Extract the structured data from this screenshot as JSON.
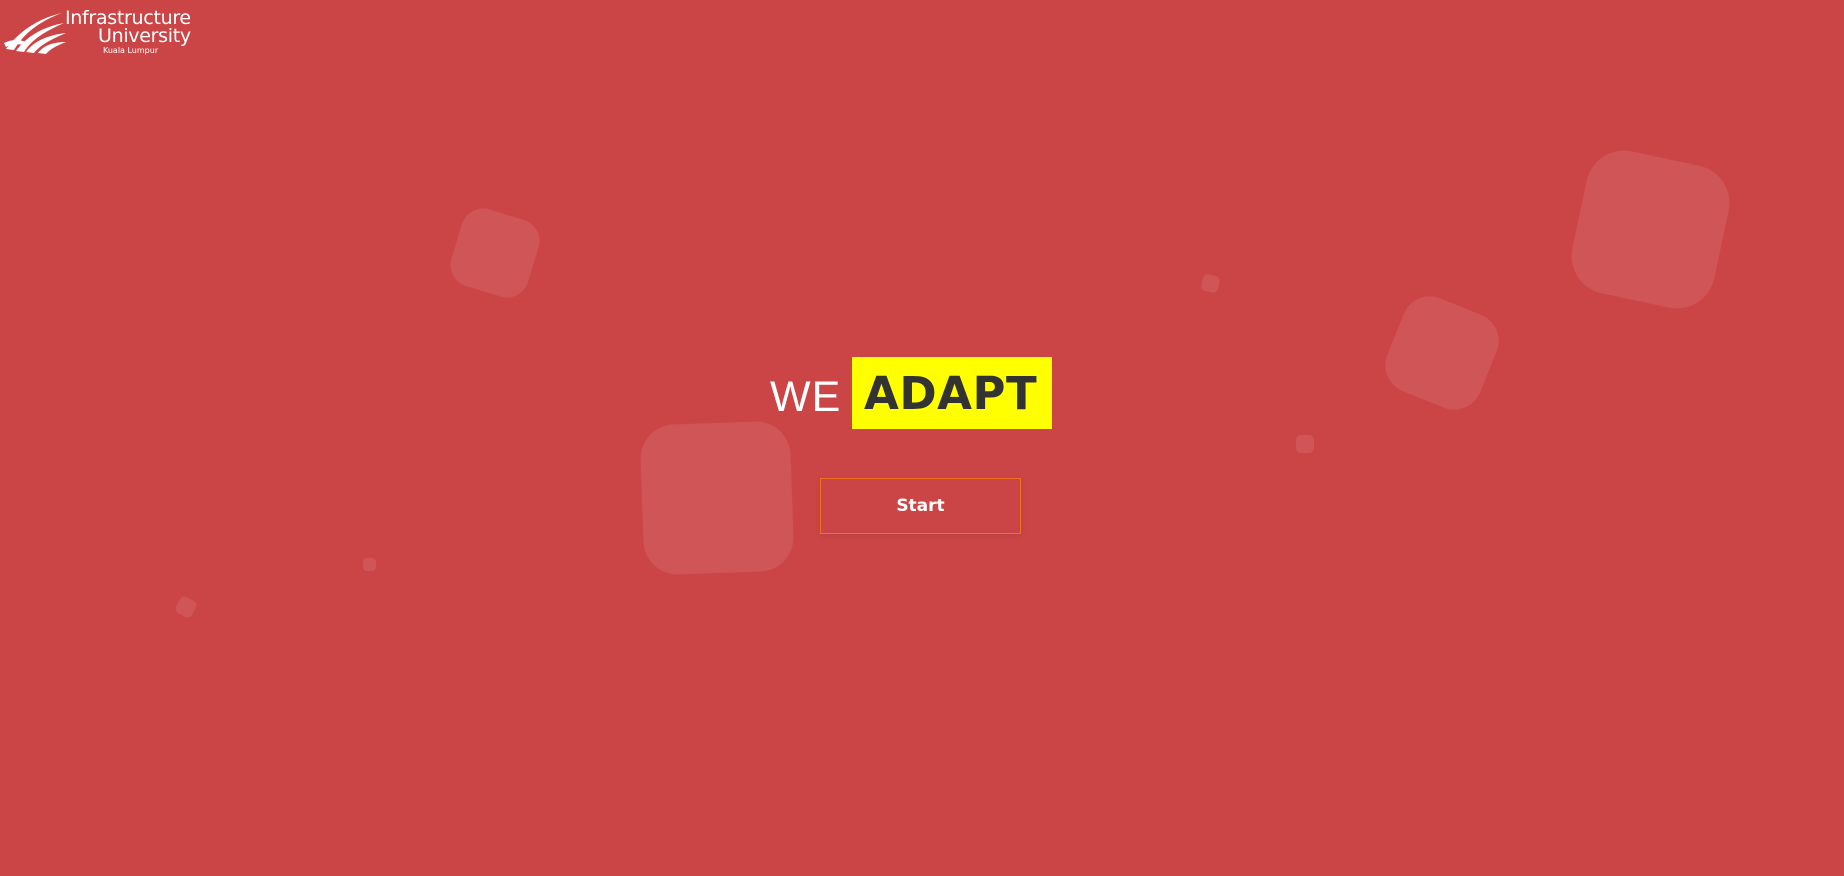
{
  "brand": {
    "line1": "Infrastructure",
    "line2": "University",
    "line3": "Kuala Lumpur",
    "logo_icon": "open-book-arcs-logo",
    "logo_color": "#ffffff"
  },
  "hero": {
    "prefix": "WE",
    "word": "ADAPT",
    "highlight_color": "#ffff00"
  },
  "start_button": {
    "label": "Start",
    "border_color": "#f07020"
  },
  "theme": {
    "background": "#cc4546"
  }
}
